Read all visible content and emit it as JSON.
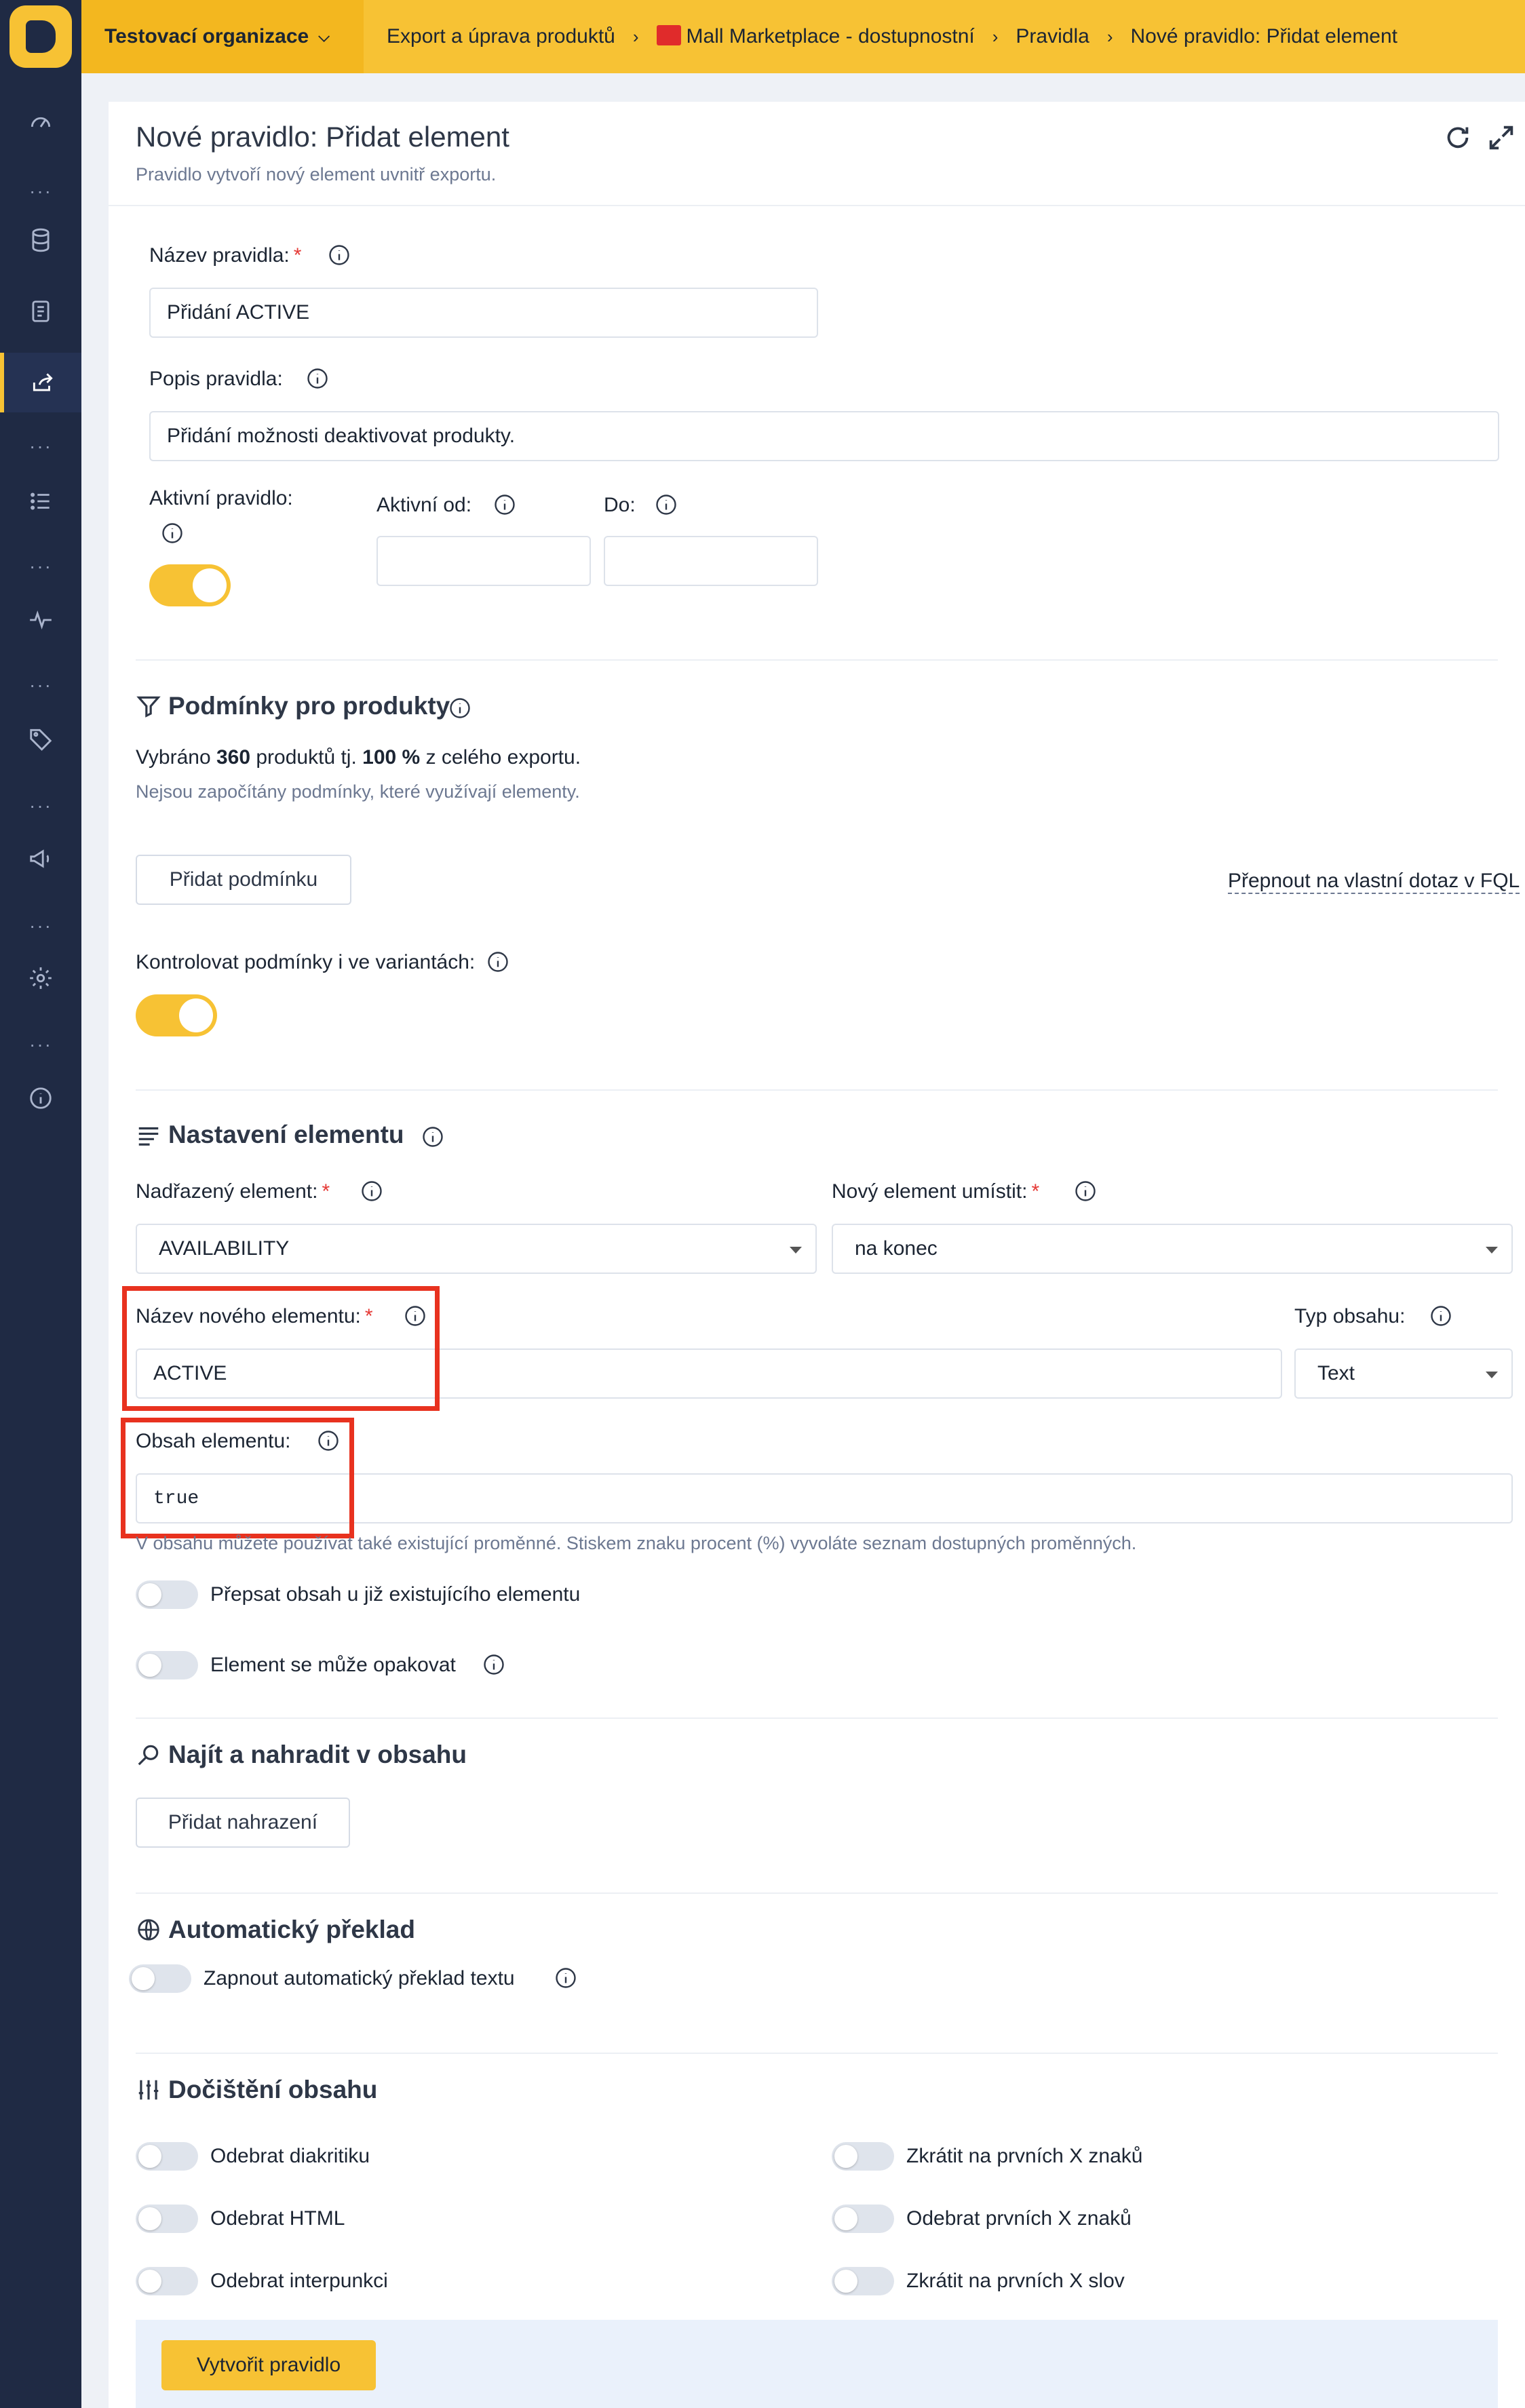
{
  "topbar": {
    "organization": "Testovací organizace",
    "breadcrumbs": [
      "Export a úprava produktů",
      "Mall Marketplace - dostupnostní",
      "Pravidla",
      "Nové pravidlo: Přidat element"
    ]
  },
  "sidebar": {
    "items": [
      "dashboard-icon",
      "database-icon",
      "document-icon",
      "export-icon",
      "list-icon",
      "activity-icon",
      "tag-icon",
      "megaphone-icon",
      "settings-icon",
      "info-icon"
    ],
    "active": "export-icon",
    "dots": "···"
  },
  "card": {
    "title": "Nové pravidlo: Přidat element",
    "subtitle": "Pravidlo vytvoří nový element uvnitř exportu."
  },
  "rule": {
    "name_label": "Název pravidla:",
    "name_value": "Přidání ACTIVE",
    "desc_label": "Popis pravidla:",
    "desc_value": "Přidání  možnosti deaktivovat produkty.",
    "active_label": "Aktivní pravidlo:",
    "active_on": true,
    "from_label": "Aktivní od:",
    "to_label": "Do:",
    "from_value": "",
    "to_value": ""
  },
  "conditions": {
    "title": "Podmínky pro produkty",
    "summary_prefix": "Vybráno",
    "count": "360",
    "summary_mid": "produktů tj.",
    "percent": "100 %",
    "summary_suffix": "z celého exportu.",
    "note": "Nejsou započítány podmínky, které využívají elementy.",
    "add_button": "Přidat podmínku",
    "fql_link": "Přepnout na vlastní dotaz v FQL",
    "variants_label": "Kontrolovat podmínky i ve variantách:",
    "variants_on": true
  },
  "element": {
    "title": "Nastavení elementu",
    "parent_label": "Nadřazený element:",
    "parent_value": "AVAILABILITY",
    "placement_label": "Nový element umístit:",
    "placement_value": "na konec",
    "name_label": "Název nového elementu:",
    "name_value": "ACTIVE",
    "type_label": "Typ obsahu:",
    "type_value": "Text",
    "content_label": "Obsah elementu:",
    "content_value": "true",
    "hint": "V obsahu můžete používat také existující proměnné. Stiskem znaku procent (%) vyvoláte seznam dostupných proměnných.",
    "overwrite_label": "Přepsat obsah u již existujícího elementu",
    "repeat_label": "Element se může opakovat"
  },
  "replace": {
    "title": "Najít a nahradit v obsahu",
    "add_button": "Přidat nahrazení"
  },
  "translate": {
    "title": "Automatický překlad",
    "toggle_label": "Zapnout automatický překlad textu"
  },
  "cleanup": {
    "title": "Dočištění obsahu",
    "left": [
      "Odebrat diakritiku",
      "Odebrat HTML",
      "Odebrat interpunkci"
    ],
    "right": [
      "Zkrátit na prvních X znaků",
      "Odebrat prvních X znaků",
      "Zkrátit na prvních X slov"
    ]
  },
  "submit_label": "Vytvořit pravidlo",
  "colors": {
    "accent": "#f7c234",
    "sidebar": "#1f2a44",
    "highlight": "#e8321f"
  }
}
